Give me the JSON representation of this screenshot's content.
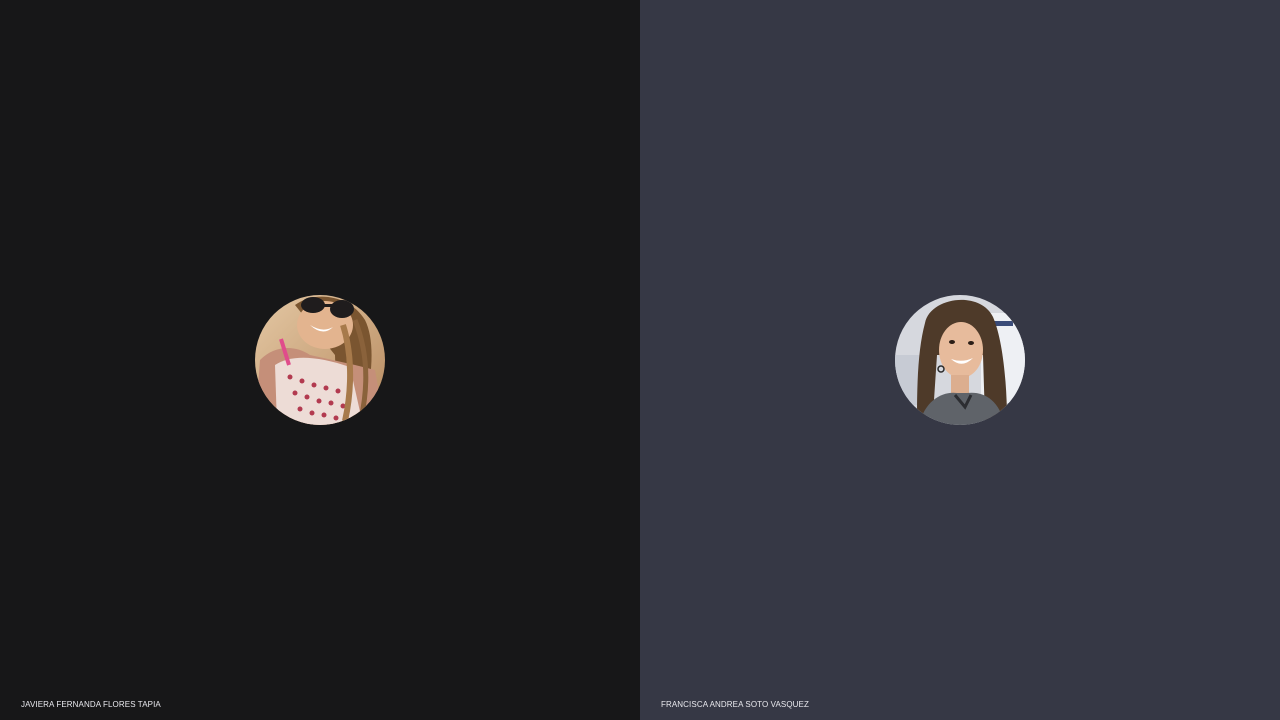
{
  "participants": [
    {
      "name": "JAVIERA FERNANDA FLORES TAPIA",
      "tile_color": "#171718",
      "avatar_icon": "participant-photo"
    },
    {
      "name": "FRANCISCA ANDREA SOTO VASQUEZ",
      "tile_color": "#363845",
      "avatar_icon": "participant-photo"
    }
  ]
}
